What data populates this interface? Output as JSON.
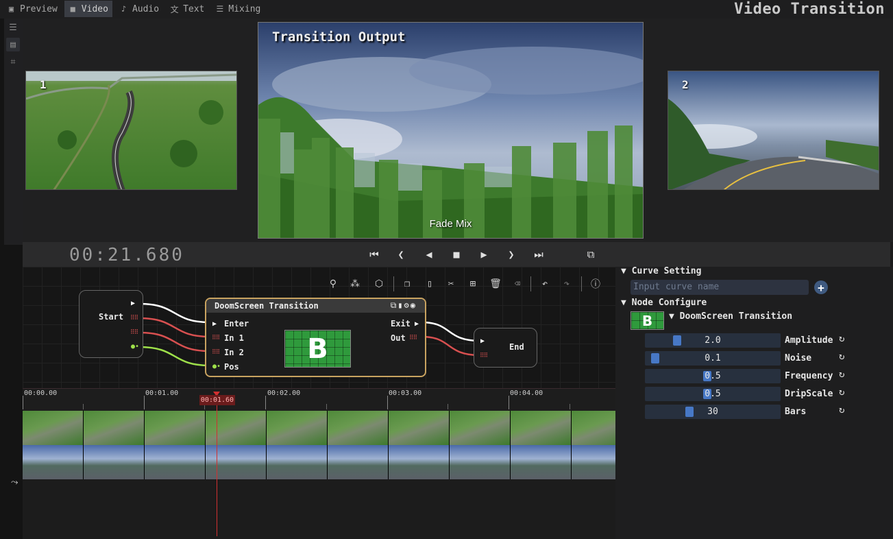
{
  "tabs": [
    {
      "label": "Preview",
      "icon": "preview-icon"
    },
    {
      "label": "Video",
      "icon": "video-camera-icon",
      "active": true
    },
    {
      "label": "Audio",
      "icon": "music-note-icon"
    },
    {
      "label": "Text",
      "icon": "translate-icon"
    },
    {
      "label": "Mixing",
      "icon": "sliders-icon"
    }
  ],
  "app_title": "Video Transition",
  "preview": {
    "input1_label": "1",
    "input2_label": "2",
    "output_title": "Transition Output",
    "output_caption": "Fade Mix"
  },
  "transport": {
    "timecode": "00:21.680"
  },
  "node_editor": {
    "start_label": "Start",
    "end_label": "End",
    "transition_title": "DoomScreen Transition",
    "inputs": [
      "Enter",
      "In 1",
      "In 2",
      "Pos"
    ],
    "outputs": [
      "Exit",
      "Out"
    ],
    "icon_letter": "B"
  },
  "timeline": {
    "ruler_labels": [
      "00:00.00",
      "00:01.00",
      "00:02.00",
      "00:03.00",
      "00:04.00"
    ],
    "playhead_time": "00:01.60"
  },
  "right_panel": {
    "curve_section": "Curve Setting",
    "curve_placeholder": "Input curve name",
    "node_section": "Node Configure",
    "node_name": "DoomScreen Transition",
    "icon_letter": "B",
    "params": [
      {
        "label": "Amplitude",
        "value": "2.0",
        "fraction": 0.21
      },
      {
        "label": "Noise",
        "value": "0.1",
        "fraction": 0.04
      },
      {
        "label": "Frequency",
        "value": "0.5",
        "fraction": 0.45
      },
      {
        "label": "DripScale",
        "value": "0.5",
        "fraction": 0.45
      },
      {
        "label": "Bars",
        "value": "30",
        "fraction": 0.31
      }
    ]
  },
  "colors": {
    "accent": "#4778c6",
    "playhead": "#d23030",
    "node_border": "#c9a360",
    "link_white": "#ffffff",
    "link_red": "#d85050",
    "link_green": "#9ee04a"
  }
}
